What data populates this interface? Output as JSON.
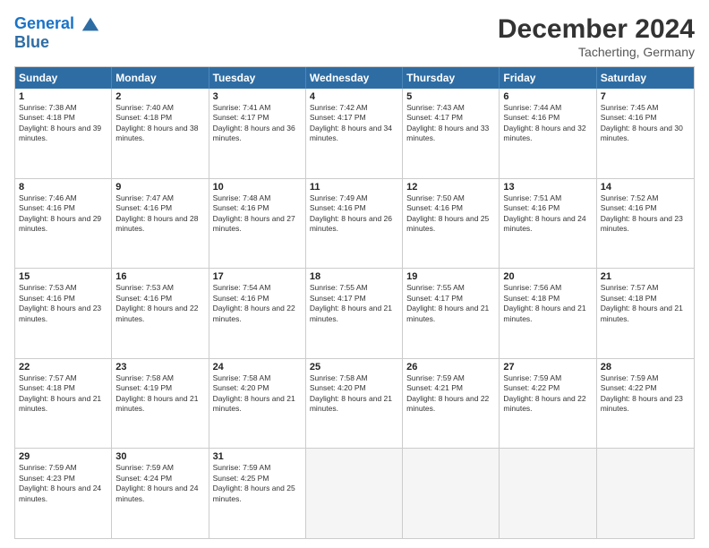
{
  "header": {
    "logo_line1": "General",
    "logo_line2": "Blue",
    "month_title": "December 2024",
    "location": "Tacherting, Germany"
  },
  "weekdays": [
    "Sunday",
    "Monday",
    "Tuesday",
    "Wednesday",
    "Thursday",
    "Friday",
    "Saturday"
  ],
  "rows": [
    [
      {
        "day": "1",
        "sunrise": "7:38 AM",
        "sunset": "4:18 PM",
        "daylight": "8 hours and 39 minutes."
      },
      {
        "day": "2",
        "sunrise": "7:40 AM",
        "sunset": "4:18 PM",
        "daylight": "8 hours and 38 minutes."
      },
      {
        "day": "3",
        "sunrise": "7:41 AM",
        "sunset": "4:17 PM",
        "daylight": "8 hours and 36 minutes."
      },
      {
        "day": "4",
        "sunrise": "7:42 AM",
        "sunset": "4:17 PM",
        "daylight": "8 hours and 34 minutes."
      },
      {
        "day": "5",
        "sunrise": "7:43 AM",
        "sunset": "4:17 PM",
        "daylight": "8 hours and 33 minutes."
      },
      {
        "day": "6",
        "sunrise": "7:44 AM",
        "sunset": "4:16 PM",
        "daylight": "8 hours and 32 minutes."
      },
      {
        "day": "7",
        "sunrise": "7:45 AM",
        "sunset": "4:16 PM",
        "daylight": "8 hours and 30 minutes."
      }
    ],
    [
      {
        "day": "8",
        "sunrise": "7:46 AM",
        "sunset": "4:16 PM",
        "daylight": "8 hours and 29 minutes."
      },
      {
        "day": "9",
        "sunrise": "7:47 AM",
        "sunset": "4:16 PM",
        "daylight": "8 hours and 28 minutes."
      },
      {
        "day": "10",
        "sunrise": "7:48 AM",
        "sunset": "4:16 PM",
        "daylight": "8 hours and 27 minutes."
      },
      {
        "day": "11",
        "sunrise": "7:49 AM",
        "sunset": "4:16 PM",
        "daylight": "8 hours and 26 minutes."
      },
      {
        "day": "12",
        "sunrise": "7:50 AM",
        "sunset": "4:16 PM",
        "daylight": "8 hours and 25 minutes."
      },
      {
        "day": "13",
        "sunrise": "7:51 AM",
        "sunset": "4:16 PM",
        "daylight": "8 hours and 24 minutes."
      },
      {
        "day": "14",
        "sunrise": "7:52 AM",
        "sunset": "4:16 PM",
        "daylight": "8 hours and 23 minutes."
      }
    ],
    [
      {
        "day": "15",
        "sunrise": "7:53 AM",
        "sunset": "4:16 PM",
        "daylight": "8 hours and 23 minutes."
      },
      {
        "day": "16",
        "sunrise": "7:53 AM",
        "sunset": "4:16 PM",
        "daylight": "8 hours and 22 minutes."
      },
      {
        "day": "17",
        "sunrise": "7:54 AM",
        "sunset": "4:16 PM",
        "daylight": "8 hours and 22 minutes."
      },
      {
        "day": "18",
        "sunrise": "7:55 AM",
        "sunset": "4:17 PM",
        "daylight": "8 hours and 21 minutes."
      },
      {
        "day": "19",
        "sunrise": "7:55 AM",
        "sunset": "4:17 PM",
        "daylight": "8 hours and 21 minutes."
      },
      {
        "day": "20",
        "sunrise": "7:56 AM",
        "sunset": "4:18 PM",
        "daylight": "8 hours and 21 minutes."
      },
      {
        "day": "21",
        "sunrise": "7:57 AM",
        "sunset": "4:18 PM",
        "daylight": "8 hours and 21 minutes."
      }
    ],
    [
      {
        "day": "22",
        "sunrise": "7:57 AM",
        "sunset": "4:18 PM",
        "daylight": "8 hours and 21 minutes."
      },
      {
        "day": "23",
        "sunrise": "7:58 AM",
        "sunset": "4:19 PM",
        "daylight": "8 hours and 21 minutes."
      },
      {
        "day": "24",
        "sunrise": "7:58 AM",
        "sunset": "4:20 PM",
        "daylight": "8 hours and 21 minutes."
      },
      {
        "day": "25",
        "sunrise": "7:58 AM",
        "sunset": "4:20 PM",
        "daylight": "8 hours and 21 minutes."
      },
      {
        "day": "26",
        "sunrise": "7:59 AM",
        "sunset": "4:21 PM",
        "daylight": "8 hours and 22 minutes."
      },
      {
        "day": "27",
        "sunrise": "7:59 AM",
        "sunset": "4:22 PM",
        "daylight": "8 hours and 22 minutes."
      },
      {
        "day": "28",
        "sunrise": "7:59 AM",
        "sunset": "4:22 PM",
        "daylight": "8 hours and 23 minutes."
      }
    ],
    [
      {
        "day": "29",
        "sunrise": "7:59 AM",
        "sunset": "4:23 PM",
        "daylight": "8 hours and 24 minutes."
      },
      {
        "day": "30",
        "sunrise": "7:59 AM",
        "sunset": "4:24 PM",
        "daylight": "8 hours and 24 minutes."
      },
      {
        "day": "31",
        "sunrise": "7:59 AM",
        "sunset": "4:25 PM",
        "daylight": "8 hours and 25 minutes."
      },
      null,
      null,
      null,
      null
    ]
  ]
}
